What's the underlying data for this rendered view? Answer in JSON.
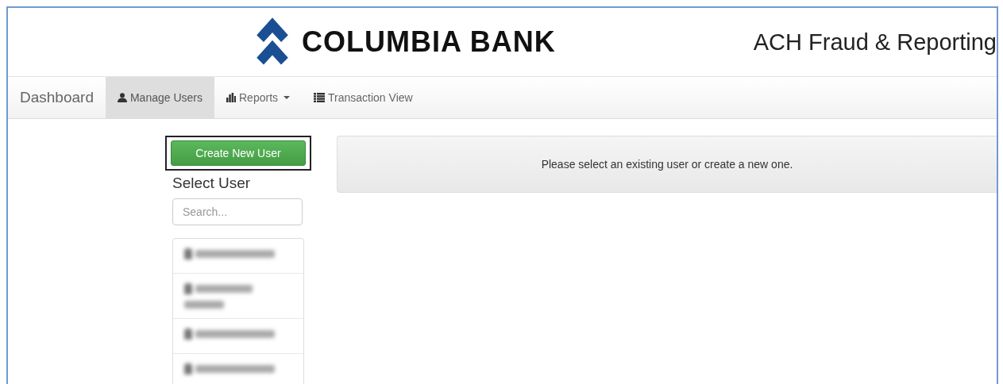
{
  "header": {
    "logo_text": "COLUMBIA BANK",
    "title": "ACH Fraud & Reporting"
  },
  "nav": [
    {
      "label": "Dashboard",
      "kind": "brand",
      "selected": false
    },
    {
      "label": "Manage Users",
      "kind": "user",
      "selected": true
    },
    {
      "label": "Reports",
      "kind": "chart",
      "selected": false,
      "dropdown": true
    },
    {
      "label": "Transaction View",
      "kind": "list",
      "selected": false
    }
  ],
  "sidebar": {
    "button": "Create New User",
    "heading": "Select User",
    "search": {
      "placeholder": "Search..."
    },
    "users": [
      {
        "kind": "one-line"
      },
      {
        "kind": "two-line"
      },
      {
        "kind": "one-line"
      },
      {
        "kind": "one-line"
      }
    ]
  },
  "message": "Please select an existing user or create a new one."
}
